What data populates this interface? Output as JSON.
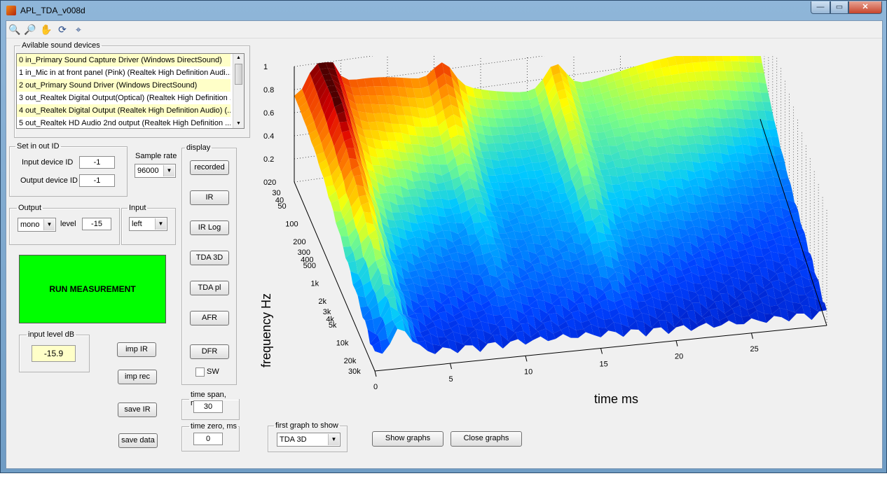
{
  "window": {
    "title": "APL_TDA_v008d",
    "buttons": {
      "min": "—",
      "max": "▭",
      "close": "✕"
    }
  },
  "toolbar": {
    "icons": [
      "zoom-in-icon",
      "zoom-out-icon",
      "pan-icon",
      "rotate-3d-icon",
      "data-cursor-icon"
    ]
  },
  "devices": {
    "legend": "Avilable sound devices",
    "items": [
      "0 in_Primary Sound Capture Driver (Windows DirectSound)",
      "1 in_Mic in at front panel (Pink) (Realtek High Definition Audi...",
      "2 out_Primary Sound Driver (Windows DirectSound)",
      "3 out_Realtek Digital Output(Optical) (Realtek High Definition ...",
      "4 out_Realtek Digital Output (Realtek High Definition Audio) (...",
      "5 out_Realtek HD Audio 2nd output (Realtek High Definition ..."
    ],
    "selected": [
      0,
      2,
      4
    ]
  },
  "inout": {
    "legend": "Set in out ID",
    "input_label": "Input device ID",
    "input_value": "-1",
    "output_label": "Output device ID",
    "output_value": "-1"
  },
  "sample_rate": {
    "label": "Sample rate",
    "value": "96000"
  },
  "output": {
    "legend": "Output",
    "mode": "mono",
    "level_label": "level",
    "level_value": "-15"
  },
  "input": {
    "legend": "Input",
    "channel": "left"
  },
  "run_button": "RUN MEASUREMENT",
  "input_level": {
    "legend": "input level dB",
    "value": "-15.9"
  },
  "buttons": {
    "imp_ir": "imp IR",
    "imp_rec": "imp rec",
    "save_ir": "save IR",
    "save_data": "save data",
    "show": "Show graphs",
    "close": "Close graphs"
  },
  "display": {
    "legend": "display",
    "buttons": [
      "recorded",
      "IR",
      "IR Log",
      "TDA 3D",
      "TDA pl",
      "AFR",
      "DFR"
    ],
    "sw_label": "SW"
  },
  "time_span": {
    "legend": "time span, ms",
    "value": "30"
  },
  "time_zero": {
    "legend": "time zero, ms",
    "value": "0"
  },
  "first_graph": {
    "legend": "first graph to show",
    "value": "TDA 3D"
  },
  "chart_data": {
    "type": "surface",
    "title": "",
    "xlabel": "time   ms",
    "ylabel": "frequency   Hz",
    "x_ticks": [
      "0",
      "5",
      "10",
      "15",
      "20",
      "25"
    ],
    "y_ticks": [
      "20",
      "30",
      "40",
      "50",
      "100",
      "200",
      "300",
      "400",
      "500",
      "1k",
      "2k",
      "3k",
      "4k",
      "5k",
      "10k",
      "20k",
      "30k"
    ],
    "z_ticks": [
      "1",
      "0.8",
      "0.6",
      "0.4",
      "0.2",
      "0"
    ],
    "xlim": [
      0,
      30
    ],
    "ylim": [
      20,
      30000
    ],
    "zlim": [
      0,
      1
    ],
    "y_scale": "log",
    "grid": true,
    "colormap": "jet"
  }
}
